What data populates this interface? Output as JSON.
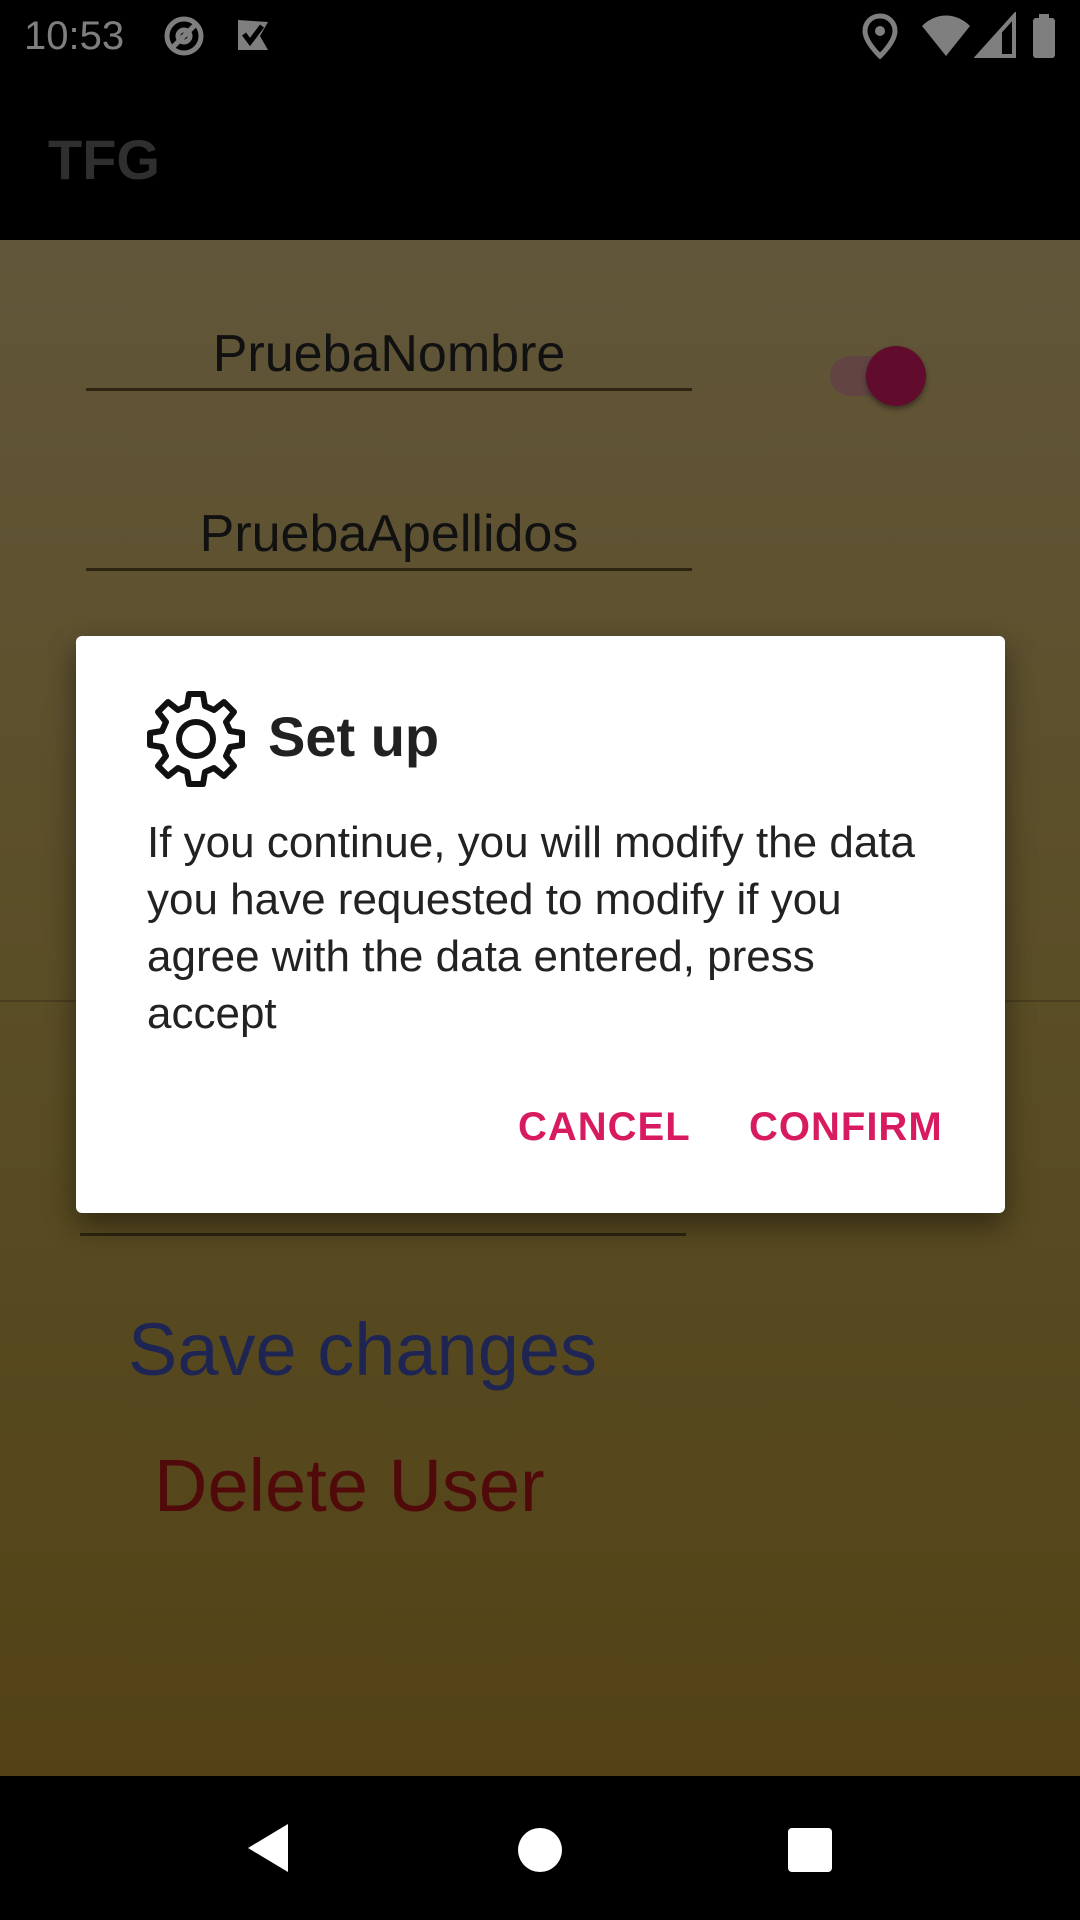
{
  "status_bar": {
    "time": "10:53",
    "left_icons": [
      "at-sign-icon",
      "check-flag-icon"
    ],
    "right_icons": [
      "location-icon",
      "wifi-icon",
      "signal-icon",
      "battery-icon"
    ]
  },
  "app_bar": {
    "title": "TFG"
  },
  "form": {
    "name_value": "PruebaNombre",
    "surname_value": "PruebaApellidos",
    "toggle_on": true,
    "save_label": "Save changes",
    "delete_label": "Delete User"
  },
  "dialog": {
    "icon": "gear-icon",
    "title": "Set up",
    "message": "If you continue, you will modify the data you have requested to modify if you agree with the data entered, press accept",
    "cancel_label": "CANCEL",
    "confirm_label": "CONFIRM"
  },
  "colors": {
    "accent": "#d81b60",
    "save": "#3e4aa6",
    "delete": "#a31515"
  },
  "nav_bar": {
    "icons": [
      "back-icon",
      "home-icon",
      "recents-icon"
    ]
  }
}
